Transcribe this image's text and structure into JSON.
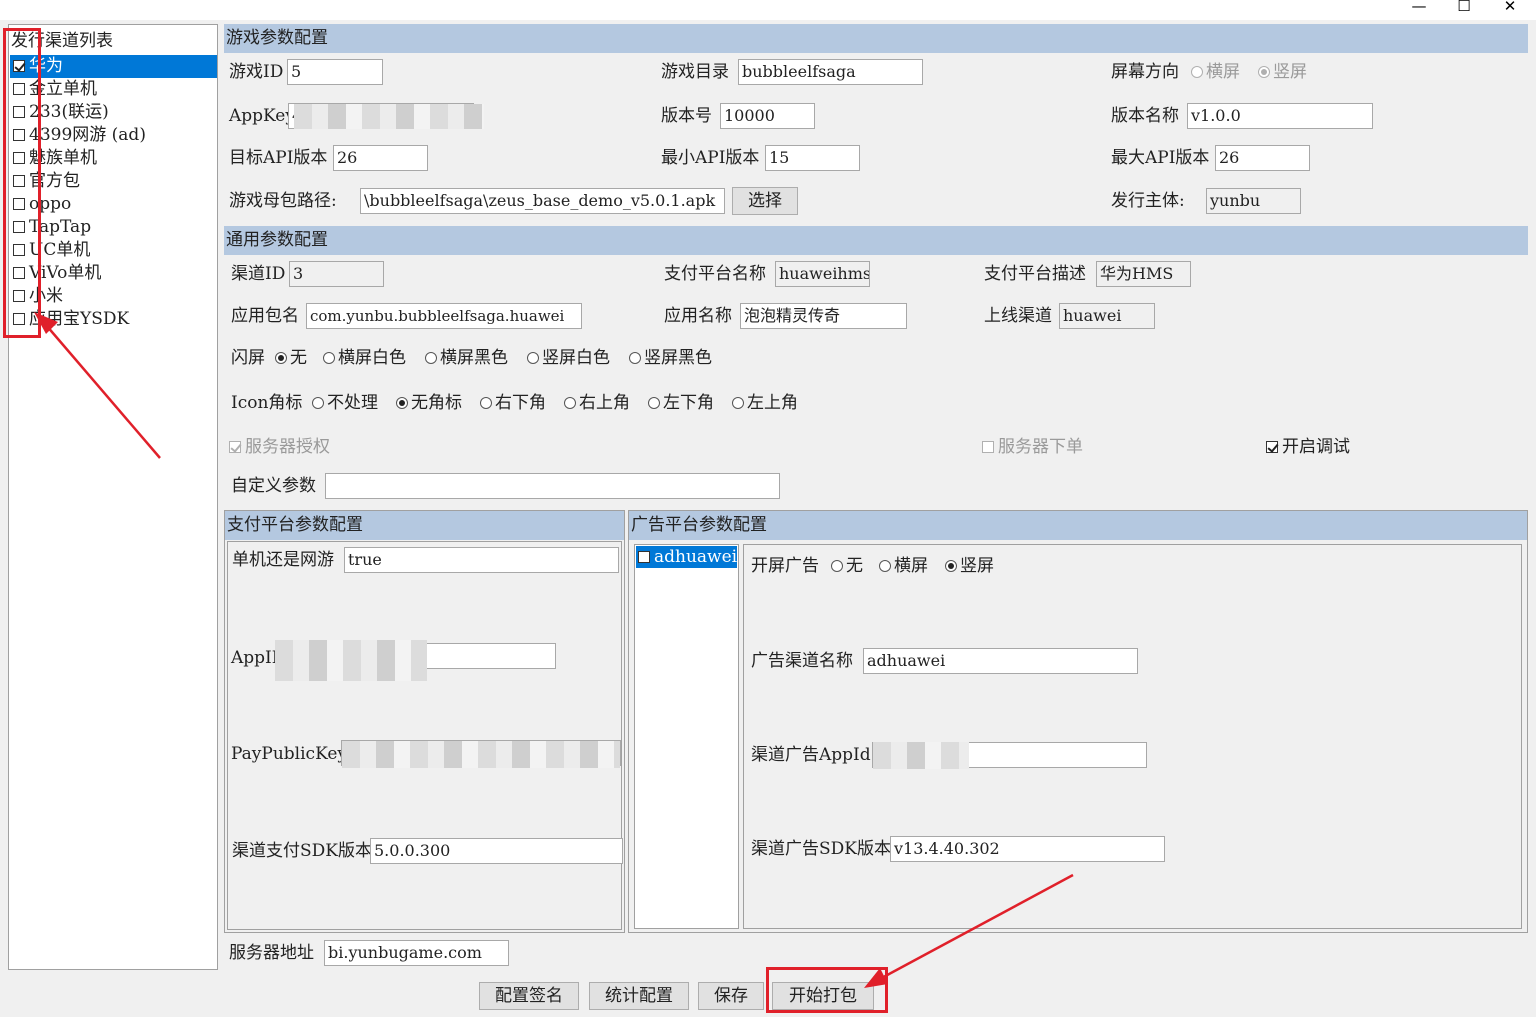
{
  "window": {
    "minimize_icon": "minimize-icon",
    "maximize_icon": "maximize-icon",
    "close_icon": "close-icon"
  },
  "channels": {
    "title": "发行渠道列表",
    "items": [
      {
        "label": "华为",
        "checked": true,
        "selected": true
      },
      {
        "label": "金立单机",
        "checked": false
      },
      {
        "label": "233(联运)",
        "checked": false
      },
      {
        "label": "4399网游 (ad)",
        "checked": false
      },
      {
        "label": "魅族单机",
        "checked": false
      },
      {
        "label": "官方包",
        "checked": false
      },
      {
        "label": "oppo",
        "checked": false
      },
      {
        "label": "TapTap",
        "checked": false
      },
      {
        "label": "UC单机",
        "checked": false
      },
      {
        "label": "ViVo单机",
        "checked": false
      },
      {
        "label": "小米",
        "checked": false
      },
      {
        "label": "应用宝YSDK",
        "checked": false
      }
    ]
  },
  "game": {
    "header": "游戏参数配置",
    "game_id_label": "游戏ID",
    "game_id": "5",
    "game_dir_label": "游戏目录",
    "game_dir": "bubbleelfsaga",
    "orientation_label": "屏幕方向",
    "orientation_options": [
      "横屏",
      "竖屏"
    ],
    "orientation_selected": "竖屏",
    "appkey_label": "AppKey",
    "appkey_prefix": "4",
    "version_code_label": "版本号",
    "version_code": "10000",
    "version_name_label": "版本名称",
    "version_name": "v1.0.0",
    "target_api_label": "目标API版本",
    "target_api": "26",
    "min_api_label": "最小API版本",
    "min_api": "15",
    "max_api_label": "最大API版本",
    "max_api": "26",
    "apk_path_label": "游戏母包路径:",
    "apk_path": "\\bubbleelfsaga\\zeus_base_demo_v5.0.1.apk",
    "choose_button": "选择",
    "publisher_label": "发行主体:",
    "publisher": "yunbu"
  },
  "common": {
    "header": "通用参数配置",
    "channel_id_label": "渠道ID",
    "channel_id": "3",
    "pay_name_label": "支付平台名称",
    "pay_name": "huaweihms",
    "pay_desc_label": "支付平台描述",
    "pay_desc": "华为HMS",
    "package_label": "应用包名",
    "package": "com.yunbu.bubbleelfsaga.huawei",
    "app_name_label": "应用名称",
    "app_name": "泡泡精灵传奇",
    "online_channel_label": "上线渠道",
    "online_channel": "huawei",
    "splash_label": "闪屏",
    "splash_options": [
      "无",
      "横屏白色",
      "横屏黑色",
      "竖屏白色",
      "竖屏黑色"
    ],
    "splash_selected": "无",
    "icon_label": "Icon角标",
    "icon_options": [
      "不处理",
      "无角标",
      "右下角",
      "右上角",
      "左下角",
      "左上角"
    ],
    "icon_selected": "无角标",
    "server_auth_label": "服务器授权",
    "server_order_label": "服务器下单",
    "debug_label": "开启调试",
    "custom_label": "自定义参数",
    "custom_value": ""
  },
  "pay": {
    "header": "支付平台参数配置",
    "mode_label": "单机还是网游",
    "mode": "true",
    "appid_label": "AppID",
    "public_key_label": "PayPublicKey",
    "sdk_version_label": "渠道支付SDK版本",
    "sdk_version": "5.0.0.300"
  },
  "ad": {
    "header": "广告平台参数配置",
    "list": [
      {
        "label": "adhuawei",
        "checked": false
      }
    ],
    "splash_label": "开屏广告",
    "splash_options": [
      "无",
      "横屏",
      "竖屏"
    ],
    "splash_selected": "竖屏",
    "channel_name_label": "广告渠道名称",
    "channel_name": "adhuawei",
    "appid_label": "渠道广告AppId",
    "sdk_version_label": "渠道广告SDK版本",
    "sdk_version": "v13.4.40.302"
  },
  "server": {
    "label": "服务器地址",
    "value": "bi.yunbugame.com"
  },
  "buttons": {
    "sign": "配置签名",
    "stats": "统计配置",
    "save": "保存",
    "build": "开始打包"
  }
}
